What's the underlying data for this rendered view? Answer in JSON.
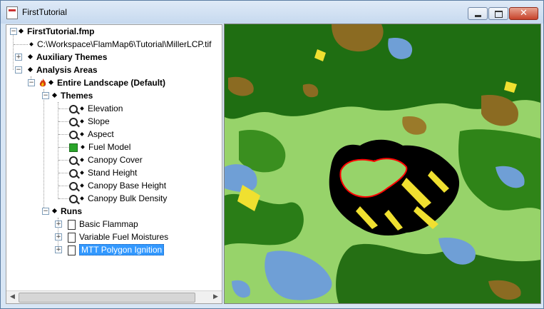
{
  "window": {
    "title": "FirstTutorial",
    "controls": {
      "minimize": "minimize",
      "maximize": "maximize",
      "close": "close"
    }
  },
  "tree": {
    "root_label": "FirstTutorial.fmp",
    "landscape_path": "C:\\Workspace\\FlamMap6\\Tutorial\\MillerLCP.tif",
    "auxiliary_themes_label": "Auxiliary Themes",
    "analysis_areas_label": "Analysis Areas",
    "entire_landscape_label": "Entire Landscape (Default)",
    "themes_label": "Themes",
    "themes": [
      {
        "label": "Elevation",
        "icon": "magnifier-icon"
      },
      {
        "label": "Slope",
        "icon": "magnifier-icon"
      },
      {
        "label": "Aspect",
        "icon": "magnifier-icon"
      },
      {
        "label": "Fuel Model",
        "icon": "fuel-model-icon"
      },
      {
        "label": "Canopy Cover",
        "icon": "magnifier-icon"
      },
      {
        "label": "Stand Height",
        "icon": "magnifier-icon"
      },
      {
        "label": "Canopy Base Height",
        "icon": "magnifier-icon"
      },
      {
        "label": "Canopy Bulk Density",
        "icon": "magnifier-icon"
      }
    ],
    "runs_label": "Runs",
    "runs": [
      {
        "label": "Basic Flammap",
        "selected": false
      },
      {
        "label": "Variable Fuel Moistures",
        "selected": false
      },
      {
        "label": "MTT Polygon Ignition",
        "selected": true
      }
    ]
  },
  "map": {
    "colors": {
      "grass_light": "#97d36a",
      "forest_dark": "#1f6e12",
      "forest_mid": "#3a8f1f",
      "shrub_brown": "#8b6b22",
      "water_blue": "#6f9fd6",
      "slash_yellow": "#f0e030",
      "burn_black": "#000000",
      "ignition_red": "#ff0000"
    }
  }
}
